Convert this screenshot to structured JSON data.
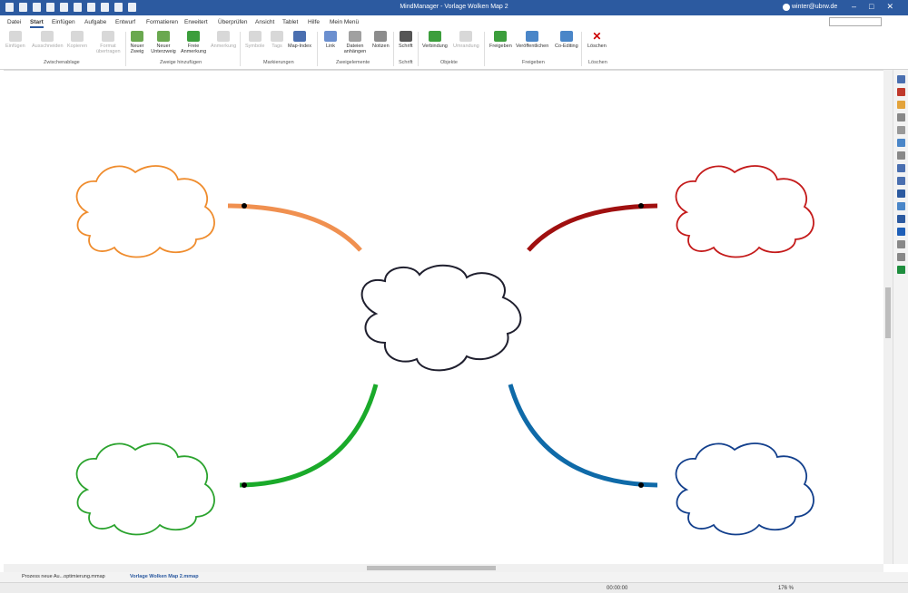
{
  "window": {
    "title": "MindManager - Vorlage Wolken Map 2",
    "user": "winter@ubrw.de",
    "minimize": "–",
    "maximize": "□",
    "close": "✕"
  },
  "tabs": [
    "Datei",
    "Start",
    "Einfügen",
    "Aufgabe",
    "Entwurf",
    "Formatieren",
    "Erweitert",
    "Überprüfen",
    "Ansicht",
    "Tablet",
    "Hilfe",
    "Mein Menü"
  ],
  "active_tab": "Start",
  "ribbon": {
    "groups": {
      "clipboard": "Zwischenablage",
      "add_branches": "Zweige hinzufügen",
      "markers": "Markierungen",
      "branch_elements": "Zweigelemente",
      "font": "Schrift",
      "objects": "Objekte",
      "share": "Freigeben",
      "delete": "Löschen"
    },
    "buttons": {
      "paste": "Einfügen",
      "cut": "Ausschneiden",
      "copy": "Kopieren",
      "format_transfer": "Format übertragen",
      "new_branch": "Neuer Zweig",
      "new_subbranch": "Neuer Unterzweig",
      "free_note": "Freie Anmerkung",
      "annotation": "Anmerkung",
      "symbols": "Symbole",
      "tags": "Tags",
      "map_index": "Map-Index",
      "link": "Link",
      "attach_files": "Dateien anhängen",
      "notes": "Notizen",
      "font": "Schrift",
      "connection": "Verbindung",
      "boundary": "Umrandung",
      "share": "Freigeben",
      "publish": "Veröffentlichen",
      "co_editing": "Co-Editing",
      "delete": "Löschen"
    }
  },
  "doc_tabs": [
    {
      "label": "Prozess neue Au...optimierung.mmap"
    },
    {
      "label": "Vorlage Wolken Map 2.mmap"
    }
  ],
  "status": {
    "time": "00:00:00",
    "zoom": "176 %"
  },
  "map": {
    "central_color": "#1f1f2e",
    "branches": [
      {
        "position": "top-left",
        "color": "#f09050",
        "cloud_color": "#ef8c2d"
      },
      {
        "position": "top-right",
        "color": "#a01010",
        "cloud_color": "#c41a1a"
      },
      {
        "position": "bottom-left",
        "color": "#1aaa2a",
        "cloud_color": "#2ba32e"
      },
      {
        "position": "bottom-right",
        "color": "#0f6aa8",
        "cloud_color": "#123f8c"
      }
    ]
  }
}
